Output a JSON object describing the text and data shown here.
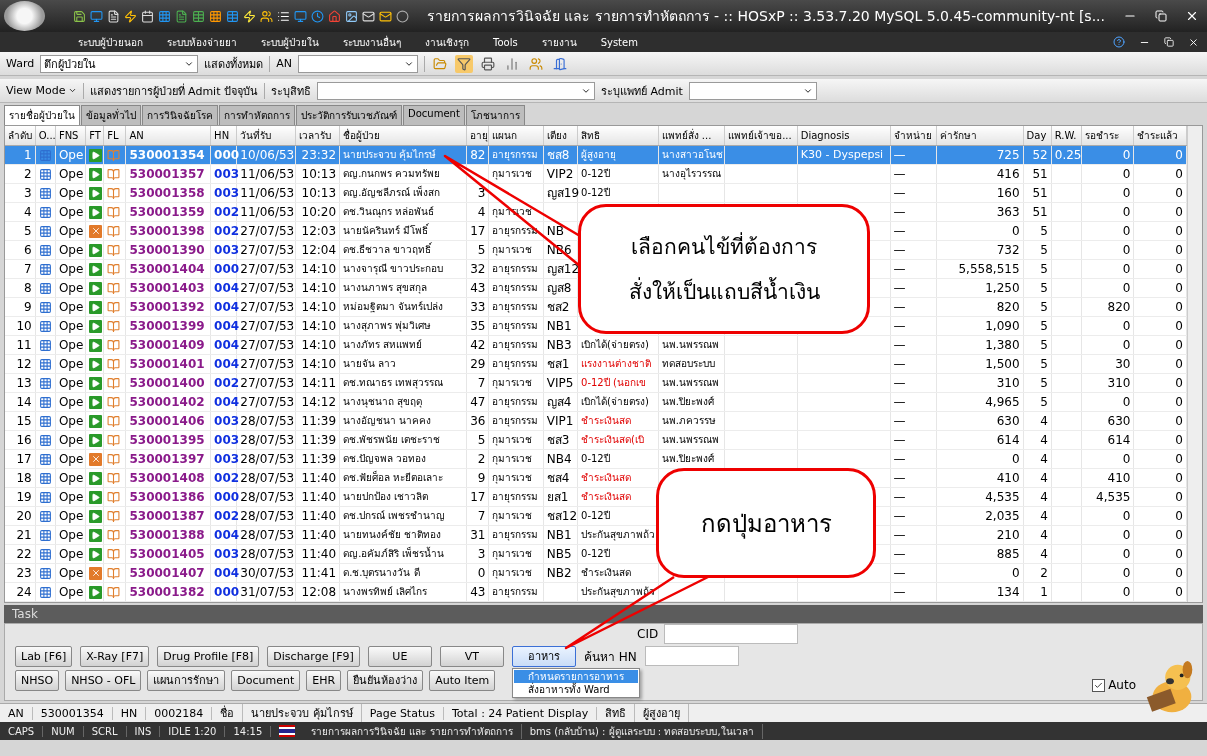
{
  "window": {
    "title": "รายการผลการวินิจฉัย และ รายการทำหัตถการ - :: HOSxP :: 3.53.7.20 MySQL 5.0.45-community-nt [s..."
  },
  "menu": [
    "ระบบผู้ป่วยนอก",
    "ระบบห้องจ่ายยา",
    "ระบบผู้ป่วยใน",
    "ระบบงานอื่นๆ",
    "งานเชิงรุก",
    "Tools",
    "รายงาน",
    "System"
  ],
  "toolbar": {
    "ward_label": "Ward",
    "ward_value": "ตึกผู้ป่วยใน",
    "show_all": "แสดงทั้งหมด",
    "an_label": "AN"
  },
  "filter_bar": {
    "view_mode": "View Mode",
    "admit_label": "แสดงรายการผู้ป่วยที่ Admit ปัจจุบัน",
    "right_label": "ระบุสิทธิ",
    "doctor_label": "ระบุแพทย์ Admit"
  },
  "tabs": [
    {
      "label": "รายชื่อผู้ป่วยใน",
      "selected": true
    },
    {
      "label": "ข้อมูลทั่วไป",
      "selected": false
    },
    {
      "label": "การวินิจฉัยโรค",
      "selected": false
    },
    {
      "label": "การทำหัตถการ",
      "selected": false
    },
    {
      "label": "ประวัติการรับเวชภัณฑ์",
      "selected": false
    },
    {
      "label": "Document",
      "selected": false
    },
    {
      "label": "โภชนาการ",
      "selected": false
    }
  ],
  "table": {
    "columns": [
      "ลำดับ",
      "O...",
      "FNS",
      "FT",
      "FL",
      "AN",
      "HN",
      "วันที่รับ",
      "เวลารับ",
      "ชื่อผู้ป่วย",
      "อายุ",
      "แผนก",
      "เตียง",
      "สิทธิ",
      "แพทย์สั่ง ...",
      "แพทย์เจ้าขอ...",
      "Diagnosis",
      "จำหน่าย",
      "ค่ารักษา",
      "Day",
      "R.W.",
      "รอชำระ",
      "ชำระแล้ว"
    ],
    "rows": [
      {
        "no": "1",
        "fns": "Ope",
        "kind": "play",
        "an": "530001354",
        "hn": "000",
        "date": "10/06/53",
        "time": "23:32",
        "name": "นายประจวบ คุ้มไกรษ์",
        "age": "82",
        "dept": "อายุรกรรม",
        "bed": "ชส8",
        "right": "ผู้สูงอายุ",
        "right_alert": false,
        "doctor": "นางสาวอโนช",
        "diagnosis": "K30 - Dyspepsi",
        "discharge": "—",
        "cost": "725",
        "day": "52",
        "rw": "0.25",
        "pending": "0",
        "paid": "0",
        "selected": true
      },
      {
        "no": "2",
        "fns": "Ope",
        "kind": "play",
        "an": "530001357",
        "hn": "003",
        "date": "11/06/53",
        "time": "10:13",
        "name": "ดญ.กนกพร ควมทรัพย",
        "dept": "กุมารเวช",
        "bed": "VIP2",
        "right": "0-12ปี",
        "right_alert": false,
        "doctor": "นางอุไรวรรณ",
        "discharge": "—",
        "cost": "416",
        "day": "51",
        "pending": "0",
        "paid": "0",
        "selected": false
      },
      {
        "no": "3",
        "fns": "Ope",
        "kind": "play",
        "an": "530001358",
        "hn": "003",
        "date": "11/06/53",
        "time": "10:13",
        "name": "ดญ.อัญชลีภรณ์ เพ็งสก",
        "age": "3",
        "bed": "ญส19",
        "right": "0-12ปี",
        "right_alert": false,
        "discharge": "—",
        "cost": "160",
        "day": "51",
        "pending": "0",
        "paid": "0",
        "selected": false
      },
      {
        "no": "4",
        "fns": "Ope",
        "kind": "play",
        "an": "530001359",
        "hn": "002",
        "date": "11/06/53",
        "time": "10:20",
        "name": "ดช.วินณุกร หล่อพันธ์",
        "age": "4",
        "dept": "กุมารเวช",
        "discharge": "—",
        "cost": "363",
        "day": "51",
        "pending": "0",
        "paid": "0",
        "selected": false
      },
      {
        "no": "5",
        "fns": "Ope",
        "kind": "cross",
        "an": "530001398",
        "hn": "002",
        "date": "27/07/53",
        "time": "12:03",
        "name": "นายนัครินทร์ มีโพธิ์",
        "age": "17",
        "dept": "อายุรกรรม",
        "bed": "NB",
        "discharge": "—",
        "cost": "0",
        "day": "5",
        "pending": "0",
        "paid": "0",
        "selected": false
      },
      {
        "no": "6",
        "fns": "Ope",
        "kind": "play",
        "an": "530001390",
        "hn": "003",
        "date": "27/07/53",
        "time": "12:04",
        "name": "ดช.ธีชวาล ขาวฤทธิ์",
        "age": "5",
        "dept": "กุมารเวช",
        "bed": "NB6",
        "discharge": "—",
        "cost": "732",
        "day": "5",
        "pending": "0",
        "paid": "0",
        "selected": false
      },
      {
        "no": "7",
        "fns": "Ope",
        "kind": "play",
        "an": "530001404",
        "hn": "000",
        "date": "27/07/53",
        "time": "14:10",
        "name": "นางจารุณี ขาวประกอบ",
        "age": "32",
        "dept": "อายุรกรรม",
        "bed": "ญส12",
        "discharge": "—",
        "cost": "5,558,515",
        "day": "5",
        "pending": "0",
        "paid": "0",
        "selected": false
      },
      {
        "no": "8",
        "fns": "Ope",
        "kind": "play",
        "an": "530001403",
        "hn": "004",
        "date": "27/07/53",
        "time": "14:10",
        "name": "นางนภาพร สุขสกุล",
        "age": "43",
        "dept": "อายุรกรรม",
        "bed": "ญส8",
        "discharge": "—",
        "cost": "1,250",
        "day": "5",
        "pending": "0",
        "paid": "0",
        "selected": false
      },
      {
        "no": "9",
        "fns": "Ope",
        "kind": "play",
        "an": "530001392",
        "hn": "004",
        "date": "27/07/53",
        "time": "14:10",
        "name": "หม่อมฐิตมา จันทร์เปล่ง",
        "age": "33",
        "dept": "อายุรกรรม",
        "bed": "ชส2",
        "discharge": "—",
        "cost": "820",
        "day": "5",
        "pending": "820",
        "paid": "0",
        "selected": false
      },
      {
        "no": "10",
        "fns": "Ope",
        "kind": "play",
        "an": "530001399",
        "hn": "004",
        "date": "27/07/53",
        "time": "14:10",
        "name": "นางสุภาพร พุ่มวิเศษ",
        "age": "35",
        "dept": "อายุรกรรม",
        "bed": "NB1",
        "discharge": "—",
        "cost": "1,090",
        "day": "5",
        "pending": "0",
        "paid": "0",
        "selected": false
      },
      {
        "no": "11",
        "fns": "Ope",
        "kind": "play",
        "an": "530001409",
        "hn": "004",
        "date": "27/07/53",
        "time": "14:10",
        "name": "นางภัทร สหแพทย์",
        "age": "42",
        "dept": "อายุรกรรม",
        "bed": "NB3",
        "right": "เบิกได้(จ่ายตรง)",
        "right_alert": false,
        "doctor": "นพ.นพรรณพ",
        "discharge": "—",
        "cost": "1,380",
        "day": "5",
        "pending": "0",
        "paid": "0",
        "selected": false
      },
      {
        "no": "12",
        "fns": "Ope",
        "kind": "play",
        "an": "530001401",
        "hn": "004",
        "date": "27/07/53",
        "time": "14:10",
        "name": "นายจัน ลาว",
        "age": "29",
        "dept": "อายุรกรรม",
        "bed": "ชส1",
        "right": "แรงงานต่างชาติ",
        "right_alert": true,
        "doctor": "ทดสอบระบบ",
        "discharge": "—",
        "cost": "1,500",
        "day": "5",
        "pending": "30",
        "paid": "0",
        "selected": false
      },
      {
        "no": "13",
        "fns": "Ope",
        "kind": "play",
        "an": "530001400",
        "hn": "002",
        "date": "27/07/53",
        "time": "14:11",
        "name": "ดช.ทณาธร เทพสุวรรณ",
        "age": "7",
        "dept": "กุมารเวช",
        "bed": "VIP5",
        "right": "0-12ปี (นอกเข",
        "right_alert": true,
        "doctor": "นพ.นพรรณพ",
        "discharge": "—",
        "cost": "310",
        "day": "5",
        "pending": "310",
        "paid": "0",
        "selected": false
      },
      {
        "no": "14",
        "fns": "Ope",
        "kind": "play",
        "an": "530001402",
        "hn": "004",
        "date": "27/07/53",
        "time": "14:12",
        "name": "นางนุชนาถ สุขฤดุ",
        "age": "47",
        "dept": "อายุรกรรม",
        "bed": "ญส4",
        "right": "เบิกได้(จ่ายตรง)",
        "right_alert": false,
        "doctor": "นพ.ปิยะพงศ์",
        "discharge": "—",
        "cost": "4,965",
        "day": "5",
        "pending": "0",
        "paid": "0",
        "selected": false
      },
      {
        "no": "15",
        "fns": "Ope",
        "kind": "play",
        "an": "530001406",
        "hn": "003",
        "date": "28/07/53",
        "time": "11:39",
        "name": "นางอัญชนา นาคคง",
        "age": "36",
        "dept": "อายุรกรรม",
        "bed": "VIP1",
        "right": "ชำระเงินสด",
        "right_alert": true,
        "doctor": "นพ.ภควรรษ",
        "discharge": "—",
        "cost": "630",
        "day": "4",
        "pending": "630",
        "paid": "0",
        "selected": false
      },
      {
        "no": "16",
        "fns": "Ope",
        "kind": "play",
        "an": "530001395",
        "hn": "003",
        "date": "28/07/53",
        "time": "11:39",
        "name": "ดช.พัชรพนัย เตชะราช",
        "age": "5",
        "dept": "กุมารเวช",
        "bed": "ชส3",
        "right": "ชำระเงินสด(เบิ",
        "right_alert": true,
        "doctor": "นพ.นพรรณพ",
        "discharge": "—",
        "cost": "614",
        "day": "4",
        "pending": "614",
        "paid": "0",
        "selected": false
      },
      {
        "no": "17",
        "fns": "Ope",
        "kind": "cross",
        "an": "530001397",
        "hn": "003",
        "date": "28/07/53",
        "time": "11:39",
        "name": "ดช.ปัญจพล วอทอง",
        "age": "2",
        "dept": "กุมารเวช",
        "bed": "NB4",
        "right": "0-12ปี",
        "right_alert": false,
        "doctor": "นพ.ปิยะพงศ์",
        "discharge": "—",
        "cost": "0",
        "day": "4",
        "pending": "0",
        "paid": "0",
        "selected": false
      },
      {
        "no": "18",
        "fns": "Ope",
        "kind": "play",
        "an": "530001408",
        "hn": "002",
        "date": "28/07/53",
        "time": "11:40",
        "name": "ดช.ฟัยศ็อล หะยีตอเลาะ",
        "age": "9",
        "dept": "กุมารเวช",
        "bed": "ชส4",
        "right": "ชำระเงินสด",
        "right_alert": true,
        "discharge": "—",
        "cost": "410",
        "day": "4",
        "pending": "410",
        "paid": "0",
        "selected": false
      },
      {
        "no": "19",
        "fns": "Ope",
        "kind": "play",
        "an": "530001386",
        "hn": "000",
        "date": "28/07/53",
        "time": "11:40",
        "name": "นายปกป้อง เชาวลิต",
        "age": "17",
        "dept": "อายุรกรรม",
        "bed": "ยส1",
        "right": "ชำระเงินสด",
        "right_alert": true,
        "discharge": "—",
        "cost": "4,535",
        "day": "4",
        "pending": "4,535",
        "paid": "0",
        "selected": false
      },
      {
        "no": "20",
        "fns": "Ope",
        "kind": "play",
        "an": "530001387",
        "hn": "002",
        "date": "28/07/53",
        "time": "11:40",
        "name": "ดช.ปกรณ์ เพชรชำนาญ",
        "age": "7",
        "dept": "กุมารเวช",
        "bed": "ชส12",
        "right": "0-12ปี",
        "right_alert": false,
        "discharge": "—",
        "cost": "2,035",
        "day": "4",
        "pending": "0",
        "paid": "0",
        "selected": false
      },
      {
        "no": "21",
        "fns": "Ope",
        "kind": "play",
        "an": "530001388",
        "hn": "004",
        "date": "28/07/53",
        "time": "11:40",
        "name": "นายทนงค์ชัย ชาติทอง",
        "age": "31",
        "dept": "อายุรกรรม",
        "bed": "NB1",
        "right": "ประกันสุขภาพถ้ว",
        "right_alert": false,
        "discharge": "—",
        "cost": "210",
        "day": "4",
        "pending": "0",
        "paid": "0",
        "selected": false
      },
      {
        "no": "22",
        "fns": "Ope",
        "kind": "play",
        "an": "530001405",
        "hn": "003",
        "date": "28/07/53",
        "time": "11:40",
        "name": "ดญ.อคัมภ์สิริ เพ็ชรน้ำน",
        "age": "3",
        "dept": "กุมารเวช",
        "bed": "NB5",
        "right": "0-12ปี",
        "right_alert": false,
        "discharge": "—",
        "cost": "885",
        "day": "4",
        "pending": "0",
        "paid": "0",
        "selected": false
      },
      {
        "no": "23",
        "fns": "Ope",
        "kind": "cross",
        "an": "530001407",
        "hn": "004",
        "date": "30/07/53",
        "time": "11:41",
        "name": "ด.ช.บุตรนางวัน ดี",
        "age": "0",
        "dept": "กุมารเวช",
        "bed": "NB2",
        "right": "ชำระเงินสด",
        "right_alert": false,
        "discharge": "—",
        "cost": "0",
        "day": "2",
        "pending": "0",
        "paid": "0",
        "selected": false
      },
      {
        "no": "24",
        "fns": "Ope",
        "kind": "play",
        "an": "530001382",
        "hn": "000",
        "date": "31/07/53",
        "time": "12:08",
        "name": "นางพรทิพย์ เลิศไกร",
        "age": "43",
        "dept": "อายุรกรรม",
        "right": "ประกันสุขภาพถ้ว",
        "right_alert": false,
        "discharge": "—",
        "cost": "134",
        "day": "1",
        "pending": "0",
        "paid": "0",
        "selected": false
      }
    ]
  },
  "callouts": [
    {
      "text_lines": [
        "เลือกคนไข้ที่ต้องการ",
        "สั่งให้เป็นแถบสีน้ำเงิน"
      ]
    },
    {
      "text_lines": [
        "กดปุ่มอาหาร"
      ]
    }
  ],
  "task": {
    "title": "Task",
    "cid_label": "CID",
    "search_hn_label": "ค้นหา HN",
    "button_rows": [
      [
        {
          "label": "Lab [F6]",
          "selected": false
        },
        {
          "label": "X-Ray [F7]",
          "selected": false
        },
        {
          "label": "Drug Profile [F8]",
          "selected": false
        },
        {
          "label": "Discharge [F9]",
          "selected": false
        },
        {
          "label": "UE",
          "selected": false
        },
        {
          "label": "VT",
          "selected": false
        },
        {
          "label": "อาหาร",
          "selected": true
        }
      ],
      [
        {
          "label": "NHSO",
          "selected": false
        },
        {
          "label": "NHSO - OFL",
          "selected": false
        },
        {
          "label": "แผนการรักษา",
          "selected": false
        },
        {
          "label": "Document",
          "selected": false
        },
        {
          "label": "EHR",
          "selected": false
        },
        {
          "label": "ยืนยันห้องว่าง",
          "selected": false
        },
        {
          "label": "Auto Item",
          "selected": false
        }
      ]
    ],
    "menu_items": [
      {
        "label": "กำหนดรายการอาหาร",
        "selected": true
      },
      {
        "label": "สั่งอาหารทั้ง Ward",
        "selected": false
      }
    ],
    "auto_checkbox": {
      "label": "Auto",
      "checked": true
    }
  },
  "status_bar": [
    {
      "label": "AN",
      "value": "530001354"
    },
    {
      "label": "HN",
      "value": "0002184"
    },
    {
      "label": "ชื่อ",
      "value": "นายประจวบ คุ้มไกรษ์"
    },
    {
      "label": "Page Status",
      "value": "Total : 24 Patient Display"
    },
    {
      "label": "สิทธิ",
      "value": "ผู้สูงอายุ"
    }
  ],
  "system_bar": [
    "CAPS",
    "NUM",
    "SCRL",
    "INS",
    "IDLE 1:20",
    "14:15",
    "รายการผลการวินิจฉัย และ รายการทำหัตถการ",
    "bms (กลับบ้าน) : ผู้ดูแลระบบ : ทดสอบระบบ,ในเวลา"
  ]
}
